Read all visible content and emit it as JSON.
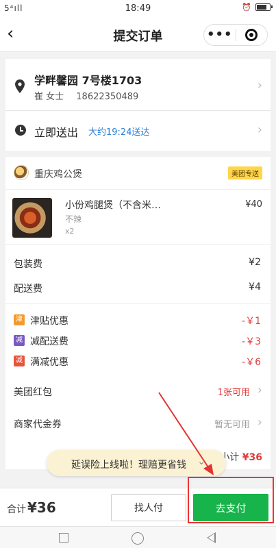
{
  "status_bar": {
    "signal": "5⁴ıll",
    "time": "18:49",
    "battery_level": 0.85
  },
  "nav": {
    "back_icon": "‹",
    "title": "提交订单",
    "more_icon": "•••"
  },
  "address": {
    "line1": "学畔馨园 7号楼1703",
    "name": "崔 女士",
    "phone": "18622350489"
  },
  "delivery": {
    "label": "立即送出",
    "eta": "大约19:24送达"
  },
  "shop": {
    "name": "重庆鸡公煲",
    "badge": "美团专送"
  },
  "item": {
    "name": "小份鸡腿煲（不含米…",
    "spec": "不辣",
    "qty": "x2",
    "price": "¥40"
  },
  "fees": [
    {
      "label": "包装费",
      "value": "¥2"
    },
    {
      "label": "配送费",
      "value": "¥4"
    }
  ],
  "discounts": [
    {
      "tag": "津",
      "tag_color": "#f39a2e",
      "label": "津贴优惠",
      "value": "-￥1"
    },
    {
      "tag": "减",
      "tag_color": "#7a5bbd",
      "label": "减配送费",
      "value": "-￥3"
    },
    {
      "tag": "减",
      "tag_color": "#e8533c",
      "label": "满减优惠",
      "value": "-￥6"
    }
  ],
  "options": [
    {
      "label": "美团红包",
      "value": "1张可用",
      "color": "#e23c3c"
    },
    {
      "label": "商家代金券",
      "value": "暂无可用",
      "color": "#999999"
    }
  ],
  "subtotal": {
    "label": "小计",
    "value": "¥36"
  },
  "toast": {
    "text": "延误险上线啦！理赔更省钱",
    "chevron": "⌄"
  },
  "footer": {
    "total_label": "合计",
    "total_value": "¥36",
    "friend_pay": "找人付",
    "pay": "去支付"
  },
  "colors": {
    "pay_green": "#17b34b",
    "price_red": "#e23c3c",
    "link_blue": "#2b7fd6",
    "annotation_red": "#e33333"
  }
}
